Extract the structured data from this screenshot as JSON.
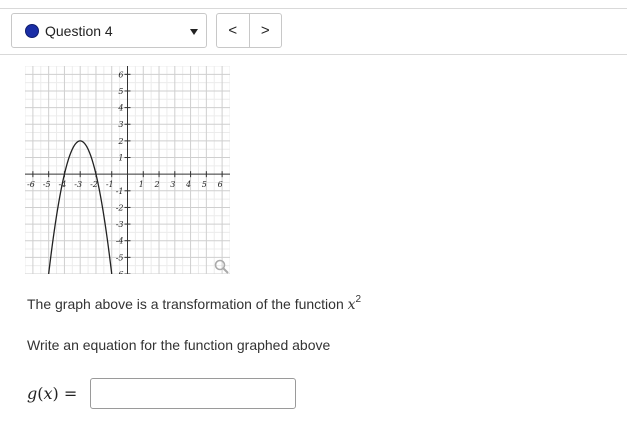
{
  "header": {
    "question_select": {
      "label": "Question 4",
      "dot_color": "#1a2ea6"
    },
    "nav": {
      "prev_label": "<",
      "next_label": ">"
    }
  },
  "graph": {
    "x_tick_labels": [
      "-6",
      "-5",
      "-4",
      "-3",
      "-2",
      "-1",
      "1",
      "2",
      "3",
      "4",
      "5",
      "6"
    ],
    "y_tick_labels": [
      "6",
      "5",
      "4",
      "3",
      "2",
      "1",
      "-1",
      "-2",
      "-3",
      "-4",
      "-5",
      "-6"
    ],
    "x_range": [
      -6.5,
      6.5
    ],
    "y_range": [
      -6,
      6.5
    ],
    "grid": true,
    "curve": {
      "type": "parabola",
      "vertex": [
        -3,
        2
      ],
      "a": -2
    },
    "zoom_icon": "magnifier-icon"
  },
  "content": {
    "statement_prefix": "The graph above is a transformation of the function ",
    "statement_var": "x",
    "statement_exp": "2",
    "instruction": "Write an equation for the function graphed above",
    "equation_label": {
      "g": "g",
      "open": "(",
      "x": "x",
      "close": ")",
      "eq": " ="
    },
    "answer_value": "",
    "answer_placeholder": ""
  }
}
